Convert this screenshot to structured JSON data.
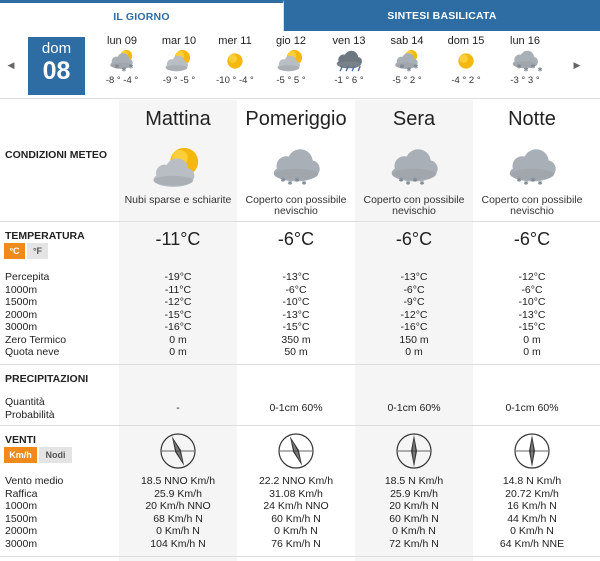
{
  "tabs": {
    "day": "IL GIORNO",
    "sintesi": "SINTESI BASILICATA"
  },
  "nav": {
    "prev_icon": "chevron-left-icon",
    "next_icon": "chevron-right-icon"
  },
  "today": {
    "name": "dom",
    "number": "08"
  },
  "days": [
    {
      "name": "lun 09",
      "icon": "snow-cloud-sun",
      "temps": "-8 ° -4 °"
    },
    {
      "name": "mar 10",
      "icon": "sun-cloud",
      "temps": "-9 ° -5 °"
    },
    {
      "name": "mer 11",
      "icon": "sun",
      "temps": "-10 ° -4 °"
    },
    {
      "name": "gio 12",
      "icon": "sun-cloud",
      "temps": "-5 ° 5 °"
    },
    {
      "name": "ven 13",
      "icon": "rain-cloud",
      "temps": "-1 ° 6 °"
    },
    {
      "name": "sab 14",
      "icon": "snow-cloud-sun",
      "temps": "-5 ° 2 °"
    },
    {
      "name": "dom 15",
      "icon": "sun",
      "temps": "-4 ° 2 °"
    },
    {
      "name": "lun 16",
      "icon": "snow-cloud",
      "temps": "-3 ° 3 °"
    }
  ],
  "periods": [
    {
      "name": "Mattina",
      "icon": "sun-cloud",
      "desc": [
        "Nubi sparse e schiarite"
      ],
      "temp": "-11°C",
      "temp_rows": [
        "-19°C",
        "-11°C",
        "-12°C",
        "-15°C",
        "-16°C",
        "0 m",
        "0 m"
      ],
      "precip": {
        "qty": "-",
        "prob": ""
      },
      "wind_dir": "NNO",
      "wind_rows": [
        "18.5 NNO Km/h",
        "25.9 Km/h",
        "20 Km/h NNO",
        "68 Km/h N",
        "0 Km/h N",
        "104 Km/h N"
      ]
    },
    {
      "name": "Pomeriggio",
      "icon": "snow-cloud",
      "desc": [
        "Coperto con possibile",
        "nevischio"
      ],
      "temp": "-6°C",
      "temp_rows": [
        "-13°C",
        "-6°C",
        "-10°C",
        "-13°C",
        "-15°C",
        "350 m",
        "50 m"
      ],
      "precip": {
        "qty": "0-1cm",
        "prob": "60%"
      },
      "wind_dir": "NNO",
      "wind_rows": [
        "22.2 NNO Km/h",
        "31.08 Km/h",
        "24 Km/h NNO",
        "60 Km/h N",
        "0 Km/h N",
        "76 Km/h N"
      ]
    },
    {
      "name": "Sera",
      "icon": "snow-cloud",
      "desc": [
        "Coperto con possibile",
        "nevischio"
      ],
      "temp": "-6°C",
      "temp_rows": [
        "-13°C",
        "-6°C",
        "-9°C",
        "-12°C",
        "-16°C",
        "150 m",
        "0 m"
      ],
      "precip": {
        "qty": "0-1cm",
        "prob": "60%"
      },
      "wind_dir": "N",
      "wind_rows": [
        "18.5 N Km/h",
        "25.9 Km/h",
        "20 Km/h N",
        "60 Km/h N",
        "0 Km/h N",
        "72 Km/h N"
      ]
    },
    {
      "name": "Notte",
      "icon": "snow-cloud",
      "desc": [
        "Coperto con possibile",
        "nevischio"
      ],
      "temp": "-6°C",
      "temp_rows": [
        "-12°C",
        "-6°C",
        "-10°C",
        "-13°C",
        "-15°C",
        "0 m",
        "0 m"
      ],
      "precip": {
        "qty": "0-1cm",
        "prob": "60%"
      },
      "wind_dir": "N",
      "wind_rows": [
        "14.8 N Km/h",
        "20.72 Km/h",
        "16 Km/h N",
        "44 Km/h N",
        "0 Km/h N",
        "64 Km/h NNE"
      ]
    }
  ],
  "sections": {
    "conditions": "CONDIZIONI METEO",
    "temperature": "TEMPERATURA",
    "precip": "PRECIPITAZIONI",
    "wind": "VENTI"
  },
  "units": {
    "celsius": "°C",
    "fahrenheit": "°F",
    "kmh": "Km/h",
    "knots": "Nodi"
  },
  "temp_labels": [
    "Percepita",
    "1000m",
    "1500m",
    "2000m",
    "3000m",
    "Zero Termico",
    "Quota neve"
  ],
  "precip_labels": [
    "Quantità",
    "Probabilità"
  ],
  "wind_labels": [
    "Vento medio",
    "Raffica",
    "1000m",
    "1500m",
    "2000m",
    "3000m"
  ],
  "colors": {
    "accent": "#2e6da4",
    "active_unit": "#f08a1c",
    "sun": "#f5b80c",
    "cloud": "#b9bec4"
  }
}
